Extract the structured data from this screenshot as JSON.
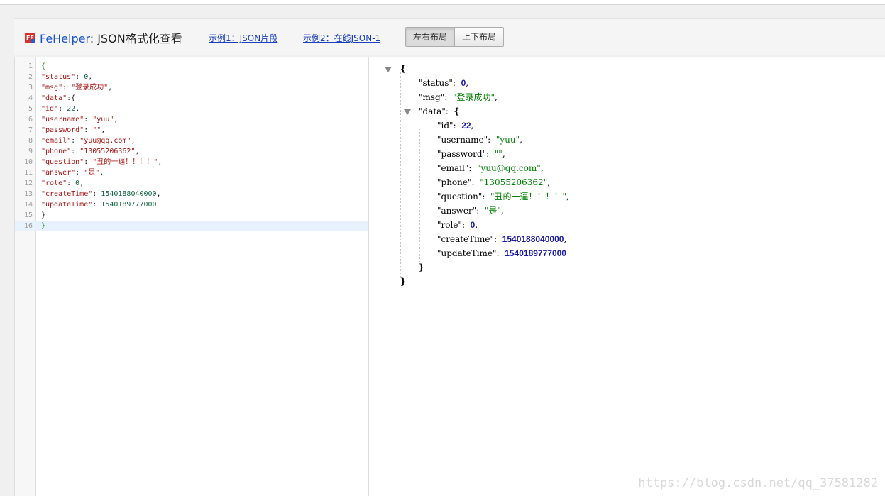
{
  "header": {
    "brand_prefix": "FeHelper",
    "brand_sep": ":",
    "brand_title": "JSON格式化查看",
    "example1": "示例1：JSON片段",
    "example2": "示例2：在线JSON-1",
    "btn_lr": "左右布局",
    "btn_tb": "上下布局"
  },
  "editor": {
    "line_numbers": [
      "1",
      "2",
      "3",
      "4",
      "5",
      "6",
      "7",
      "8",
      "9",
      "10",
      "11",
      "12",
      "13",
      "14",
      "15",
      "16"
    ],
    "lines": [
      [
        {
          "t": "{",
          "c": "t-bg"
        }
      ],
      [
        {
          "t": "\"status\"",
          "c": "t-key"
        },
        {
          "t": ": ",
          "c": "t-pu"
        },
        {
          "t": "0",
          "c": "t-num"
        },
        {
          "t": ",",
          "c": "t-pu"
        }
      ],
      [
        {
          "t": "\"msg\"",
          "c": "t-key"
        },
        {
          "t": ": ",
          "c": "t-pu"
        },
        {
          "t": "\"登录成功\"",
          "c": "t-str"
        },
        {
          "t": ",",
          "c": "t-pu"
        }
      ],
      [
        {
          "t": "\"data\"",
          "c": "t-key"
        },
        {
          "t": ":{",
          "c": "t-pu"
        }
      ],
      [
        {
          "t": "\"id\"",
          "c": "t-key"
        },
        {
          "t": ": ",
          "c": "t-pu"
        },
        {
          "t": "22",
          "c": "t-num"
        },
        {
          "t": ",",
          "c": "t-pu"
        }
      ],
      [
        {
          "t": "\"username\"",
          "c": "t-key"
        },
        {
          "t": ": ",
          "c": "t-pu"
        },
        {
          "t": "\"yuu\"",
          "c": "t-str"
        },
        {
          "t": ",",
          "c": "t-pu"
        }
      ],
      [
        {
          "t": "\"password\"",
          "c": "t-key"
        },
        {
          "t": ": ",
          "c": "t-pu"
        },
        {
          "t": "\"\"",
          "c": "t-str"
        },
        {
          "t": ",",
          "c": "t-pu"
        }
      ],
      [
        {
          "t": "\"email\"",
          "c": "t-key"
        },
        {
          "t": ": ",
          "c": "t-pu"
        },
        {
          "t": "\"yuu@qq.com\"",
          "c": "t-str"
        },
        {
          "t": ",",
          "c": "t-pu"
        }
      ],
      [
        {
          "t": "\"phone\"",
          "c": "t-key"
        },
        {
          "t": ": ",
          "c": "t-pu"
        },
        {
          "t": "\"13055206362\"",
          "c": "t-str"
        },
        {
          "t": ",",
          "c": "t-pu"
        }
      ],
      [
        {
          "t": "\"question\"",
          "c": "t-key"
        },
        {
          "t": ": ",
          "c": "t-pu"
        },
        {
          "t": "\"丑的一逼！！！！\"",
          "c": "t-str"
        },
        {
          "t": ",",
          "c": "t-pu"
        }
      ],
      [
        {
          "t": "\"answer\"",
          "c": "t-key"
        },
        {
          "t": ": ",
          "c": "t-pu"
        },
        {
          "t": "\"是\"",
          "c": "t-str"
        },
        {
          "t": ",",
          "c": "t-pu"
        }
      ],
      [
        {
          "t": "\"role\"",
          "c": "t-key"
        },
        {
          "t": ": ",
          "c": "t-pu"
        },
        {
          "t": "0",
          "c": "t-num"
        },
        {
          "t": ",",
          "c": "t-pu"
        }
      ],
      [
        {
          "t": "\"createTime\"",
          "c": "t-key"
        },
        {
          "t": ": ",
          "c": "t-pu"
        },
        {
          "t": "1540188040000",
          "c": "t-num"
        },
        {
          "t": ",",
          "c": "t-pu"
        }
      ],
      [
        {
          "t": "\"updateTime\"",
          "c": "t-key"
        },
        {
          "t": ": ",
          "c": "t-pu"
        },
        {
          "t": "1540189777000",
          "c": "t-num"
        }
      ],
      [
        {
          "t": "}",
          "c": "t-br"
        }
      ],
      [
        {
          "t": "}",
          "c": "t-bg"
        }
      ]
    ]
  },
  "viewer": {
    "rows": [
      {
        "indent": 0,
        "toggle": true,
        "parts": [
          {
            "t": "{",
            "c": "v-br"
          }
        ]
      },
      {
        "indent": 1,
        "parts": [
          {
            "t": "\"status\"",
            "c": "v-key"
          },
          {
            "t": ":  ",
            "c": "v-key"
          },
          {
            "t": "0",
            "c": "v-bnum"
          },
          {
            "t": ",",
            "c": "v-key"
          }
        ]
      },
      {
        "indent": 1,
        "parts": [
          {
            "t": "\"msg\"",
            "c": "v-key"
          },
          {
            "t": ":  ",
            "c": "v-key"
          },
          {
            "t": "\"登录成功\"",
            "c": "v-str"
          },
          {
            "t": ",",
            "c": "v-key"
          }
        ]
      },
      {
        "indent": 1,
        "toggle": true,
        "parts": [
          {
            "t": "\"data\"",
            "c": "v-key"
          },
          {
            "t": ":  ",
            "c": "v-key"
          },
          {
            "t": "{",
            "c": "v-br"
          }
        ]
      },
      {
        "indent": 2,
        "parts": [
          {
            "t": "\"id\"",
            "c": "v-key"
          },
          {
            "t": ":  ",
            "c": "v-key"
          },
          {
            "t": "22",
            "c": "v-bnum"
          },
          {
            "t": ",",
            "c": "v-key"
          }
        ]
      },
      {
        "indent": 2,
        "parts": [
          {
            "t": "\"username\"",
            "c": "v-key"
          },
          {
            "t": ":  ",
            "c": "v-key"
          },
          {
            "t": "\"yuu\"",
            "c": "v-str"
          },
          {
            "t": ",",
            "c": "v-key"
          }
        ]
      },
      {
        "indent": 2,
        "parts": [
          {
            "t": "\"password\"",
            "c": "v-key"
          },
          {
            "t": ":  ",
            "c": "v-key"
          },
          {
            "t": "\"\"",
            "c": "v-str"
          },
          {
            "t": ",",
            "c": "v-key"
          }
        ]
      },
      {
        "indent": 2,
        "parts": [
          {
            "t": "\"email\"",
            "c": "v-key"
          },
          {
            "t": ":  ",
            "c": "v-key"
          },
          {
            "t": "\"yuu@qq.com\"",
            "c": "v-str"
          },
          {
            "t": ",",
            "c": "v-key"
          }
        ]
      },
      {
        "indent": 2,
        "parts": [
          {
            "t": "\"phone\"",
            "c": "v-key"
          },
          {
            "t": ":  ",
            "c": "v-key"
          },
          {
            "t": "\"13055206362\"",
            "c": "v-str"
          },
          {
            "t": ",",
            "c": "v-key"
          }
        ]
      },
      {
        "indent": 2,
        "parts": [
          {
            "t": "\"question\"",
            "c": "v-key"
          },
          {
            "t": ":  ",
            "c": "v-key"
          },
          {
            "t": "\"丑的一逼！！！！\"",
            "c": "v-str"
          },
          {
            "t": ",",
            "c": "v-key"
          }
        ]
      },
      {
        "indent": 2,
        "parts": [
          {
            "t": "\"answer\"",
            "c": "v-key"
          },
          {
            "t": ":  ",
            "c": "v-key"
          },
          {
            "t": "\"是\"",
            "c": "v-str"
          },
          {
            "t": ",",
            "c": "v-key"
          }
        ]
      },
      {
        "indent": 2,
        "parts": [
          {
            "t": "\"role\"",
            "c": "v-key"
          },
          {
            "t": ":  ",
            "c": "v-key"
          },
          {
            "t": "0",
            "c": "v-bnum"
          },
          {
            "t": ",",
            "c": "v-key"
          }
        ]
      },
      {
        "indent": 2,
        "parts": [
          {
            "t": "\"createTime\"",
            "c": "v-key"
          },
          {
            "t": ":  ",
            "c": "v-key"
          },
          {
            "t": "1540188040000",
            "c": "v-bnum"
          },
          {
            "t": ",",
            "c": "v-key"
          }
        ]
      },
      {
        "indent": 2,
        "parts": [
          {
            "t": "\"updateTime\"",
            "c": "v-key"
          },
          {
            "t": ":  ",
            "c": "v-key"
          },
          {
            "t": "1540189777000",
            "c": "v-bnum"
          }
        ]
      },
      {
        "indent": 1,
        "parts": [
          {
            "t": "}",
            "c": "v-br"
          }
        ]
      },
      {
        "indent": 0,
        "parts": [
          {
            "t": "}",
            "c": "v-br"
          }
        ]
      }
    ]
  },
  "watermark": "https://blog.csdn.net/qq_37581282"
}
